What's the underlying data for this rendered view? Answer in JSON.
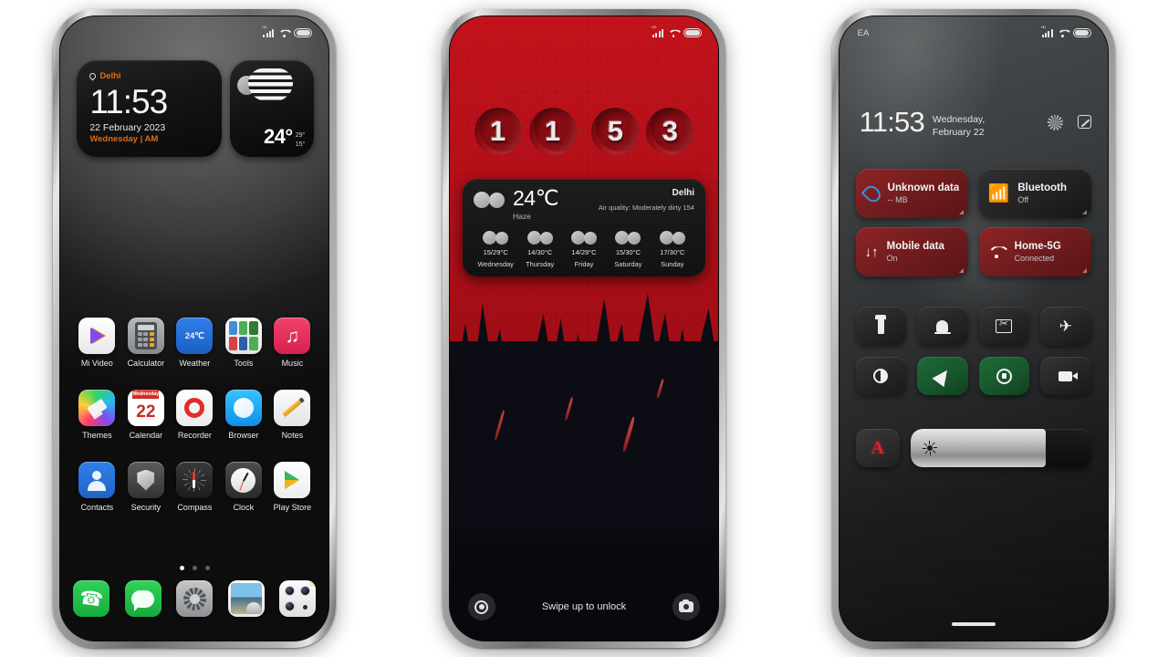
{
  "phone_home": {
    "statusbar": {
      "signal": "signal-icon",
      "wifi": "wifi-icon",
      "battery": "battery-icon",
      "hd": "HD"
    },
    "clock_widget": {
      "city": "Delhi",
      "time": "11:53",
      "date": "22 February 2023",
      "day_meridiem": "Wednesday | AM"
    },
    "weather_widget": {
      "temp": "24°",
      "high": "29°",
      "low": "15°",
      "condition_icon": "haze-icon"
    },
    "apps": [
      [
        {
          "label": "Mi Video",
          "icon": "mi-video-icon"
        },
        {
          "label": "Calculator",
          "icon": "calculator-icon"
        },
        {
          "label": "Weather",
          "icon": "weather-icon",
          "badge": "24℃"
        },
        {
          "label": "Tools",
          "icon": "tools-folder-icon"
        },
        {
          "label": "Music",
          "icon": "music-icon"
        }
      ],
      [
        {
          "label": "Themes",
          "icon": "themes-icon"
        },
        {
          "label": "Calendar",
          "icon": "calendar-icon",
          "cal_weekday": "Wednesday",
          "cal_day": "22"
        },
        {
          "label": "Recorder",
          "icon": "recorder-icon"
        },
        {
          "label": "Browser",
          "icon": "browser-icon"
        },
        {
          "label": "Notes",
          "icon": "notes-icon"
        }
      ],
      [
        {
          "label": "Contacts",
          "icon": "contacts-icon"
        },
        {
          "label": "Security",
          "icon": "security-icon"
        },
        {
          "label": "Compass",
          "icon": "compass-icon"
        },
        {
          "label": "Clock",
          "icon": "clock-icon"
        },
        {
          "label": "Play Store",
          "icon": "play-store-icon"
        }
      ]
    ],
    "page_dots": {
      "count": 3,
      "active": 1
    },
    "dock": [
      {
        "label": "Phone",
        "icon": "phone-icon"
      },
      {
        "label": "Messages",
        "icon": "messages-icon"
      },
      {
        "label": "Settings",
        "icon": "settings-icon"
      },
      {
        "label": "Gallery",
        "icon": "gallery-icon"
      },
      {
        "label": "Camera",
        "icon": "camera-icon"
      }
    ]
  },
  "phone_lock": {
    "time_digits": [
      "1",
      "1",
      "5",
      "3"
    ],
    "colon": ":",
    "weather": {
      "temp": "24℃",
      "condition": "Haze",
      "city": "Delhi",
      "air_quality": "Air quality: Moderately dirty 154",
      "forecast": [
        {
          "day": "Wednesday",
          "temps": "15/29°C"
        },
        {
          "day": "Thursday",
          "temps": "14/30°C"
        },
        {
          "day": "Friday",
          "temps": "14/29°C"
        },
        {
          "day": "Saturday",
          "temps": "15/30°C"
        },
        {
          "day": "Sunday",
          "temps": "17/30°C"
        }
      ]
    },
    "footer": {
      "unlock_hint": "Swipe up to unlock",
      "left_icon": "fingerprint-icon",
      "right_icon": "camera-icon"
    }
  },
  "phone_control_center": {
    "statusbar": {
      "carrier": "EA"
    },
    "header": {
      "time": "11:53",
      "date": "Wednesday, February 22"
    },
    "tiles": [
      {
        "title": "Unknown data plan",
        "sub": "-- MB",
        "icon": "data-drop-icon",
        "state": "red"
      },
      {
        "title": "Bluetooth",
        "sub": "Off",
        "icon": "bluetooth-icon",
        "state": "dark"
      },
      {
        "title": "Mobile data",
        "sub": "On",
        "icon": "mobile-data-icon",
        "state": "red"
      },
      {
        "title": "Home-5G",
        "sub": "Connected",
        "icon": "wifi-icon",
        "state": "red"
      }
    ],
    "quick_toggles": [
      {
        "name": "flashlight-icon",
        "on": false
      },
      {
        "name": "ringtone-bell-icon",
        "on": false
      },
      {
        "name": "screenshot-icon",
        "on": false
      },
      {
        "name": "airplane-mode-icon",
        "on": false
      },
      {
        "name": "dark-mode-icon",
        "on": false
      },
      {
        "name": "location-icon",
        "on": true
      },
      {
        "name": "auto-rotate-lock-icon",
        "on": true
      },
      {
        "name": "screen-recorder-icon",
        "on": false
      }
    ],
    "brightness": {
      "auto_label": "A",
      "value_percent": 75,
      "icon": "brightness-sun-icon"
    }
  },
  "colors": {
    "accent_orange": "#e06a10",
    "accent_red": "#b00f18",
    "tile_red": "#8e2426",
    "tile_green": "#1f6b37",
    "frame_silver": "#b9b9b9"
  }
}
